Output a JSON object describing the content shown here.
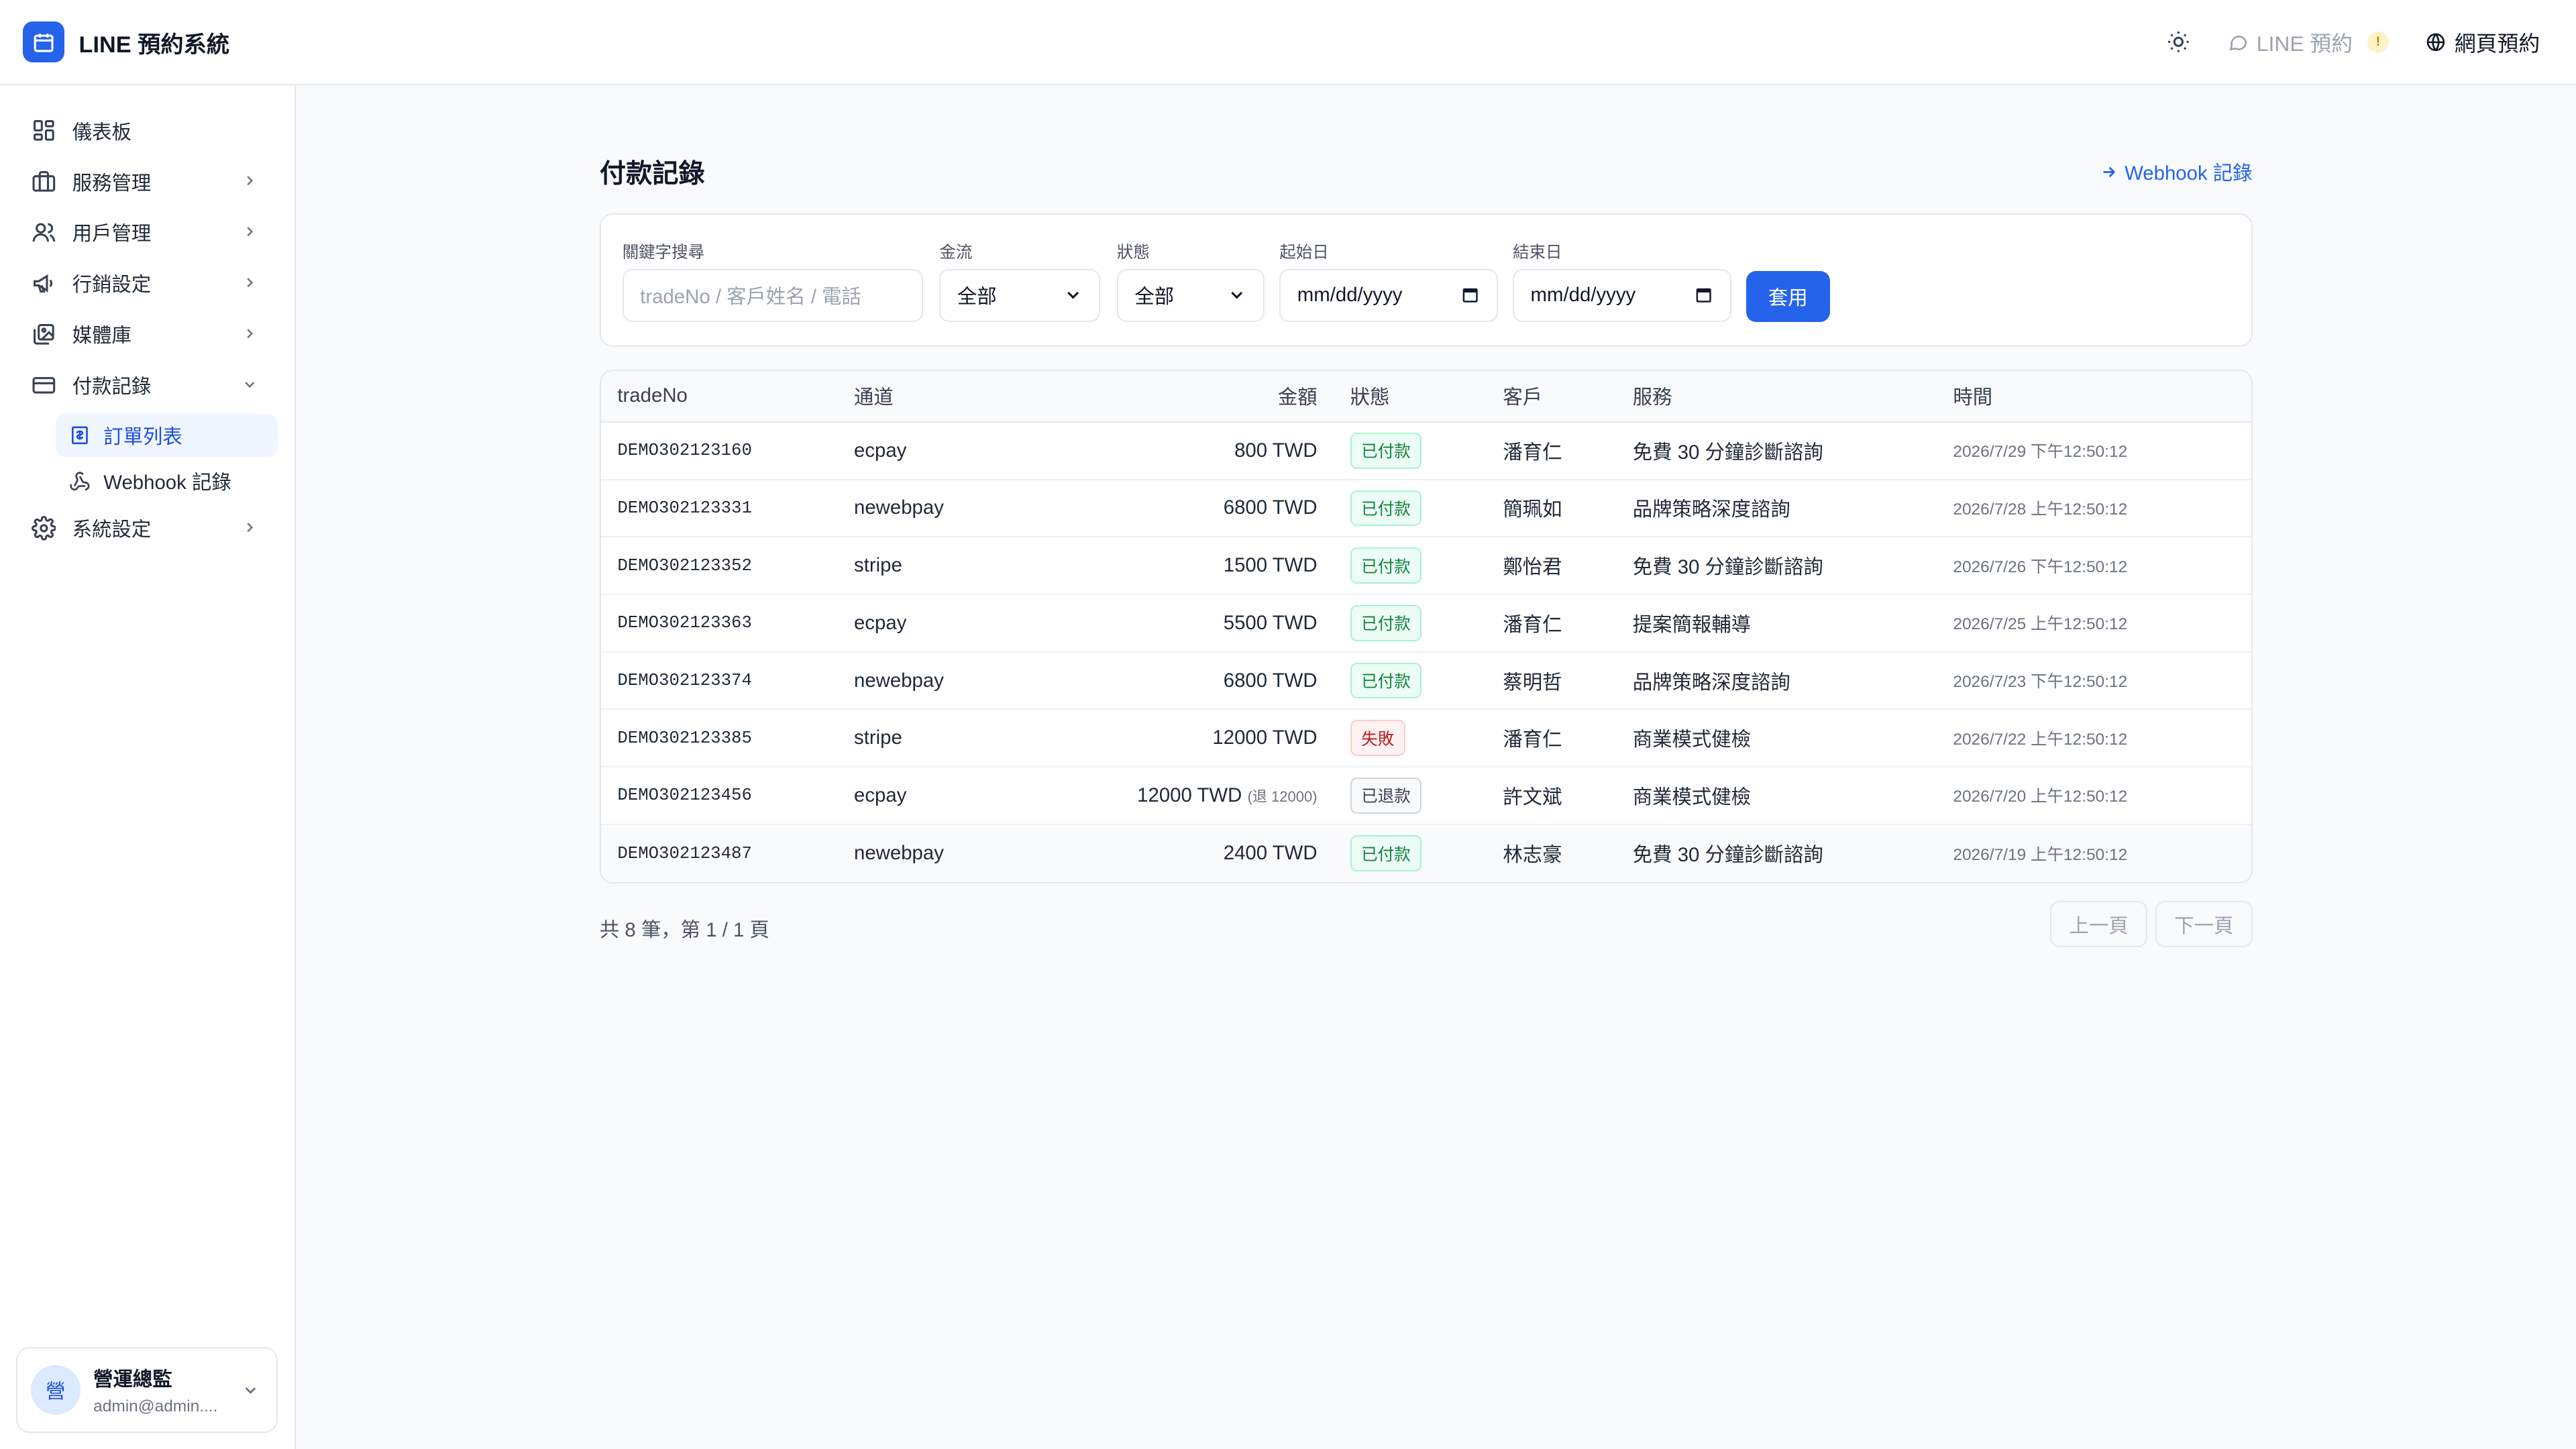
{
  "app": {
    "title": "LINE 預約系統"
  },
  "header": {
    "line_label": "LINE 預約",
    "line_badge": "!",
    "web_label": "網頁預約"
  },
  "sidebar": {
    "items": [
      {
        "label": "儀表板",
        "icon": "dashboard-icon"
      },
      {
        "label": "服務管理",
        "icon": "briefcase-icon"
      },
      {
        "label": "用戶管理",
        "icon": "users-icon"
      },
      {
        "label": "行銷設定",
        "icon": "megaphone-icon"
      },
      {
        "label": "媒體庫",
        "icon": "image-library-icon"
      },
      {
        "label": "付款記錄",
        "icon": "credit-card-icon"
      },
      {
        "label": "系統設定",
        "icon": "gear-icon"
      }
    ],
    "sub_items": [
      {
        "label": "訂單列表",
        "active": true
      },
      {
        "label": "Webhook 記錄",
        "active": false
      }
    ],
    "user": {
      "avatar": "營",
      "name": "營運總監",
      "email": "admin@admin...."
    }
  },
  "page": {
    "title": "付款記錄",
    "webhook_link": "Webhook 記錄"
  },
  "filters": {
    "keyword_label": "關鍵字搜尋",
    "keyword_placeholder": "tradeNo / 客戶姓名 / 電話",
    "gateway_label": "金流",
    "gateway_value": "全部",
    "status_label": "狀態",
    "status_value": "全部",
    "start_label": "起始日",
    "start_value": "mm/dd/yyyy",
    "end_label": "結束日",
    "end_value": "mm/dd/yyyy",
    "apply_label": "套用"
  },
  "table": {
    "columns": [
      "tradeNo",
      "通道",
      "金額",
      "狀態",
      "客戶",
      "服務",
      "時間"
    ],
    "rows": [
      {
        "trade_no": "DEMO302123160",
        "channel": "ecpay",
        "amount": "800 TWD",
        "refund": "",
        "status": "已付款",
        "customer": "潘育仁",
        "service": "免費 30 分鐘診斷諮詢",
        "time": "2026/7/29 下午12:50:12"
      },
      {
        "trade_no": "DEMO302123331",
        "channel": "newebpay",
        "amount": "6800 TWD",
        "refund": "",
        "status": "已付款",
        "customer": "簡珮如",
        "service": "品牌策略深度諮詢",
        "time": "2026/7/28 上午12:50:12"
      },
      {
        "trade_no": "DEMO302123352",
        "channel": "stripe",
        "amount": "1500 TWD",
        "refund": "",
        "status": "已付款",
        "customer": "鄭怡君",
        "service": "免費 30 分鐘診斷諮詢",
        "time": "2026/7/26 下午12:50:12"
      },
      {
        "trade_no": "DEMO302123363",
        "channel": "ecpay",
        "amount": "5500 TWD",
        "refund": "",
        "status": "已付款",
        "customer": "潘育仁",
        "service": "提案簡報輔導",
        "time": "2026/7/25 上午12:50:12"
      },
      {
        "trade_no": "DEMO302123374",
        "channel": "newebpay",
        "amount": "6800 TWD",
        "refund": "",
        "status": "已付款",
        "customer": "蔡明哲",
        "service": "品牌策略深度諮詢",
        "time": "2026/7/23 下午12:50:12"
      },
      {
        "trade_no": "DEMO302123385",
        "channel": "stripe",
        "amount": "12000 TWD",
        "refund": "",
        "status": "失敗",
        "customer": "潘育仁",
        "service": "商業模式健檢",
        "time": "2026/7/22 上午12:50:12"
      },
      {
        "trade_no": "DEMO302123456",
        "channel": "ecpay",
        "amount": "12000 TWD",
        "refund": "(退 12000)",
        "status": "已退款",
        "customer": "許文斌",
        "service": "商業模式健檢",
        "time": "2026/7/20 上午12:50:12"
      },
      {
        "trade_no": "DEMO302123487",
        "channel": "newebpay",
        "amount": "2400 TWD",
        "refund": "",
        "status": "已付款",
        "customer": "林志豪",
        "service": "免費 30 分鐘診斷諮詢",
        "time": "2026/7/19 上午12:50:12"
      }
    ]
  },
  "pager": {
    "info": "共 8 筆，第 1 / 1 頁",
    "prev": "上一頁",
    "next": "下一頁"
  },
  "colors": {
    "accent": "#2563eb",
    "paid": "#15803d",
    "failed": "#b91c1c"
  }
}
